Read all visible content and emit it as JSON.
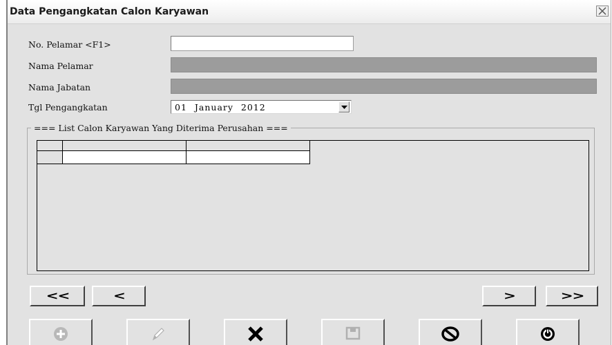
{
  "window": {
    "title": "Data Pengangkatan Calon Karyawan",
    "close_icon": "close-icon"
  },
  "form": {
    "no_pelamar_label": "No. Pelamar <F1>",
    "no_pelamar_value": "",
    "nama_pelamar_label": "Nama Pelamar",
    "nama_pelamar_value": "",
    "nama_jabatan_label": "Nama Jabatan",
    "nama_jabatan_value": "",
    "tgl_label": "Tgl Pengangkatan",
    "tgl_value": "01 January 2012"
  },
  "list": {
    "title": "=== List Calon Karyawan Yang Diterima Perusahan ===",
    "columns": [
      "",
      ""
    ],
    "rows": [
      [
        "",
        ""
      ]
    ]
  },
  "navigation": {
    "first_label": "<<",
    "prev_label": "<",
    "next_label": ">",
    "last_label": ">>"
  },
  "actions": [
    {
      "name": "add",
      "icon": "plus-icon",
      "enabled": false
    },
    {
      "name": "edit",
      "icon": "pencil-icon",
      "enabled": false
    },
    {
      "name": "delete",
      "icon": "x-icon",
      "enabled": true
    },
    {
      "name": "save",
      "icon": "save-icon",
      "enabled": false
    },
    {
      "name": "cancel",
      "icon": "no-entry-icon",
      "enabled": true
    },
    {
      "name": "exit",
      "icon": "power-icon",
      "enabled": true
    }
  ],
  "colors": {
    "window_bg": "#e2e2e2",
    "disabled_field": "#9c9c9c",
    "disabled_icon": "#b8b8b8",
    "enabled_icon": "#000000"
  }
}
